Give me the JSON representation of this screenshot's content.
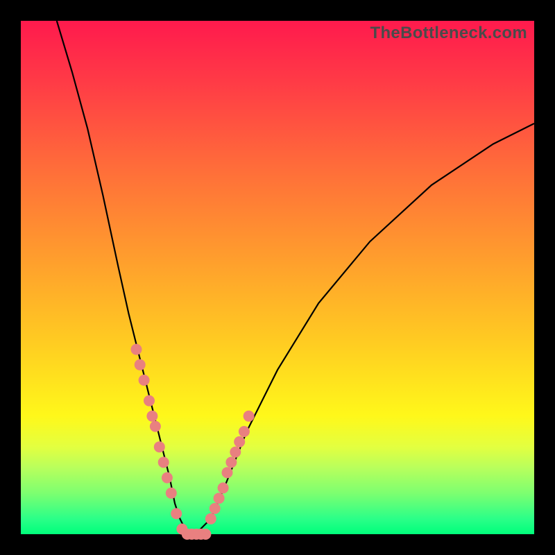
{
  "watermark": "TheBottleneck.com",
  "chart_data": {
    "type": "line",
    "title": "",
    "xlabel": "",
    "ylabel": "",
    "xlim": [
      0,
      100
    ],
    "ylim": [
      0,
      100
    ],
    "grid": false,
    "curve": {
      "description": "bottleneck curve (approximate % vs component ratio)",
      "x": [
        7,
        10,
        13,
        16,
        19,
        21,
        23,
        25,
        27,
        29,
        30,
        31,
        32,
        33,
        34,
        35,
        37,
        40,
        44,
        50,
        58,
        68,
        80,
        92,
        100
      ],
      "y": [
        100,
        90,
        79,
        66,
        52,
        43,
        35,
        27,
        19,
        11,
        6,
        3,
        1,
        0,
        0,
        1,
        3,
        10,
        20,
        32,
        45,
        57,
        68,
        76,
        80
      ]
    },
    "series": [
      {
        "name": "left-cluster-dots",
        "type": "scatter",
        "color": "#e98080",
        "x": [
          22.5,
          23.2,
          24.0,
          25.0,
          25.6,
          26.2,
          27.0,
          27.8,
          28.5,
          29.3,
          30.3,
          31.4
        ],
        "y": [
          36,
          33,
          30,
          26,
          23,
          21,
          17,
          14,
          11,
          8,
          4,
          1
        ]
      },
      {
        "name": "trough-dots",
        "type": "scatter",
        "color": "#e98080",
        "x": [
          32.4,
          33.3,
          34.2,
          35.1,
          36.0
        ],
        "y": [
          0,
          0,
          0,
          0,
          0
        ]
      },
      {
        "name": "right-cluster-dots",
        "type": "scatter",
        "color": "#e98080",
        "x": [
          37.0,
          37.8,
          38.6,
          39.4,
          40.2,
          41.0,
          41.8,
          42.6,
          43.5,
          44.4
        ],
        "y": [
          3,
          5,
          7,
          9,
          12,
          14,
          16,
          18,
          20,
          23
        ]
      }
    ]
  }
}
